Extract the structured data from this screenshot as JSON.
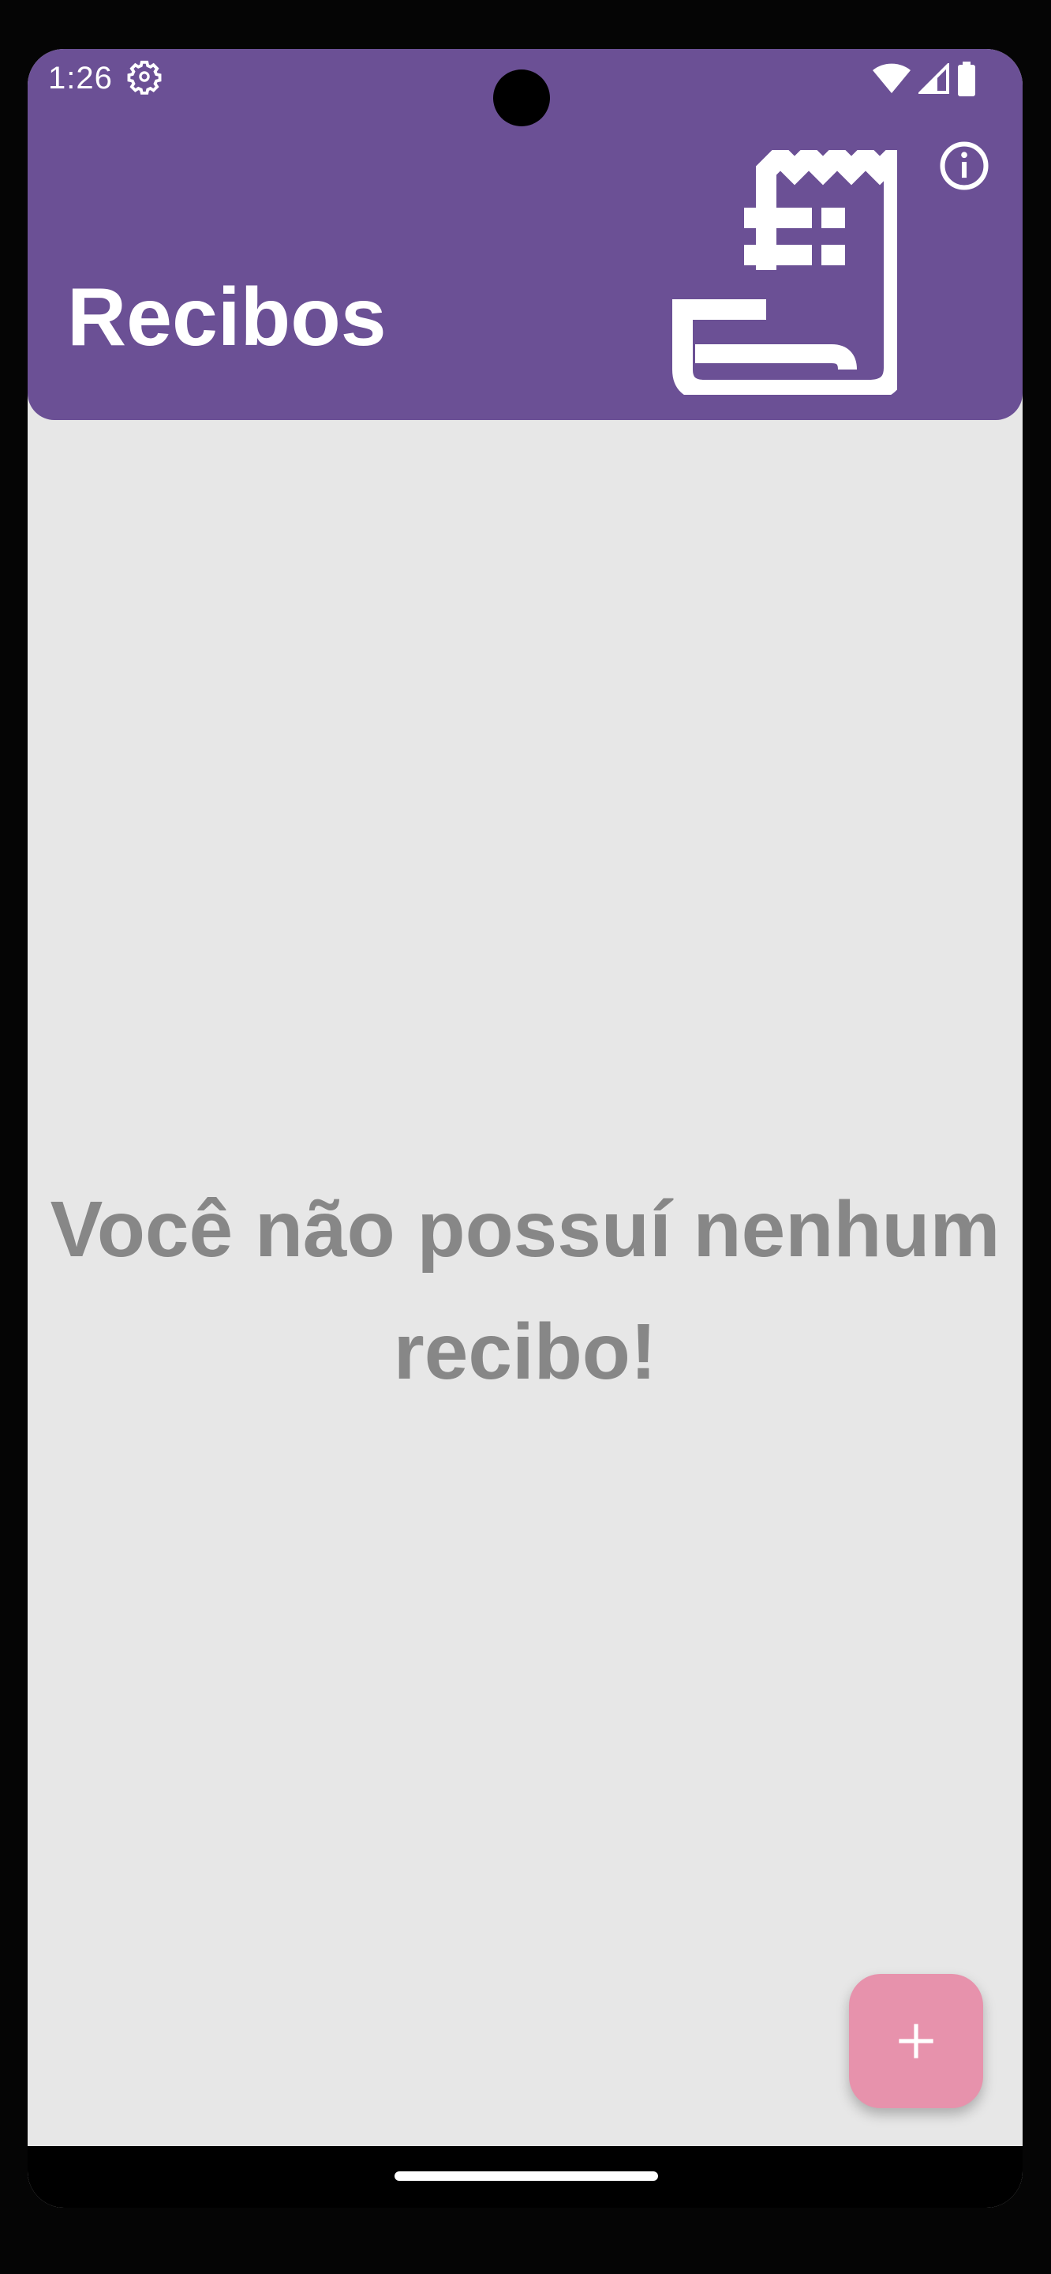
{
  "status_bar": {
    "time": "1:26",
    "icons": [
      "settings-gear-icon",
      "wifi-icon",
      "signal-icon",
      "battery-icon"
    ]
  },
  "app_bar": {
    "title": "Recibos",
    "info_icon": "info-circle-icon",
    "illustration_icon": "receipt-icon",
    "background_color": "#6b5095"
  },
  "main": {
    "empty_line1": "Você não possuí nenhum",
    "empty_line2": "recibo!",
    "text_color": "#878787",
    "background_color": "#e7e7e7"
  },
  "fab": {
    "icon": "plus-icon",
    "color": "#e792ac"
  }
}
